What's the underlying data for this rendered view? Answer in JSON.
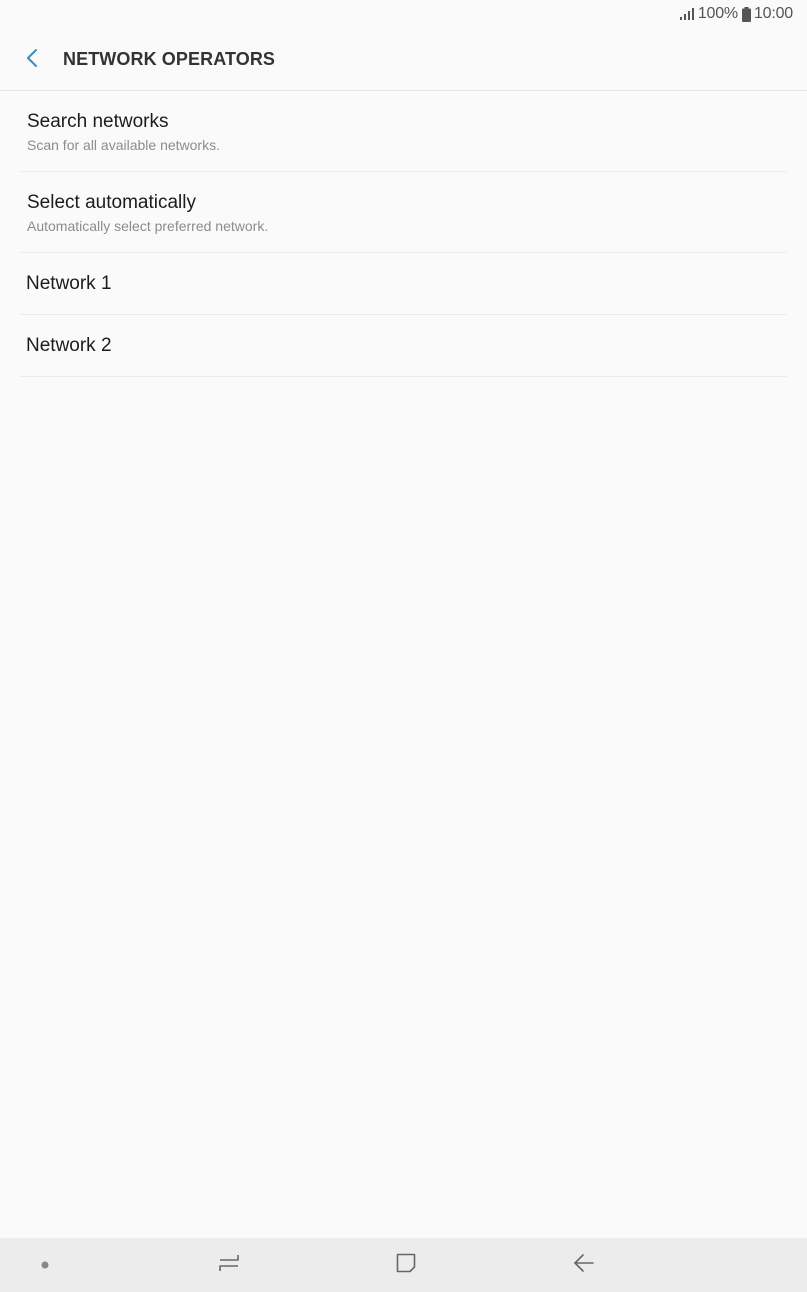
{
  "status_bar": {
    "battery_percent": "100%",
    "time": "10:00",
    "icons": [
      "signal-icon",
      "battery-icon"
    ]
  },
  "header": {
    "title": "NETWORK OPERATORS",
    "back_icon": "chevron-left-icon"
  },
  "list": {
    "items": [
      {
        "title": "Search networks",
        "subtitle": "Scan for all available networks."
      },
      {
        "title": "Select automatically",
        "subtitle": "Automatically select preferred network."
      },
      {
        "title": "Network 1"
      },
      {
        "title": "Network 2"
      }
    ]
  },
  "nav_bar": {
    "icons": [
      "dot-icon",
      "recent-apps-icon",
      "home-icon",
      "back-arrow-icon"
    ]
  },
  "colors": {
    "background": "#fafafa",
    "accent": "#3a8fb7",
    "nav_background": "#ececec"
  }
}
